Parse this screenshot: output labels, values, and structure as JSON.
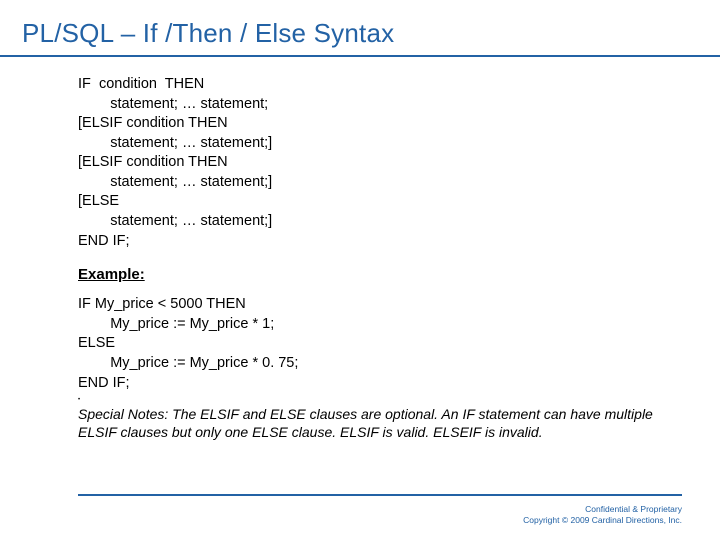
{
  "title": "PL/SQL – If /Then / Else Syntax",
  "syntax": "IF  condition  THEN\n        statement; … statement;\n[ELSIF condition THEN\n        statement; … statement;]\n[ELSIF condition THEN\n        statement; … statement;]\n[ELSE\n        statement; … statement;]\nEND IF;",
  "example_heading": "Example:",
  "example": "IF My_price < 5000 THEN\n        My_price := My_price * 1;\nELSE\n        My_price := My_price * 0. 75;\nEND IF;",
  "notes": "Special Notes: The ELSIF and ELSE clauses are optional.  An IF statement can have multiple ELSIF clauses but only one ELSE clause.  ELSIF is valid.  ELSEIF is invalid.",
  "footer": {
    "line1": "Confidential & Proprietary",
    "line2": "Copyright © 2009 Cardinal Directions, Inc."
  }
}
